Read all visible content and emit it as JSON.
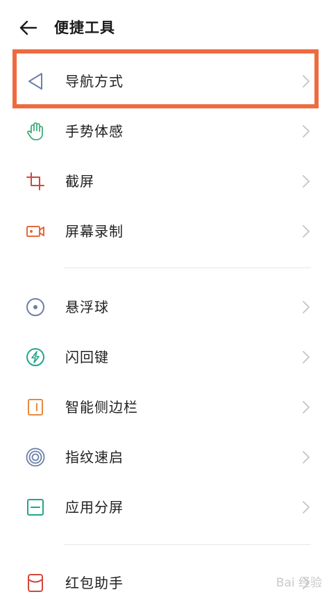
{
  "header": {
    "title": "便捷工具"
  },
  "items": [
    {
      "label": "导航方式",
      "icon": "navigation-triangle-icon",
      "color": "#6b7fa8"
    },
    {
      "label": "手势体感",
      "icon": "hand-gesture-icon",
      "color": "#3fae7a"
    },
    {
      "label": "截屏",
      "icon": "crop-screenshot-icon",
      "color": "#d2463c"
    },
    {
      "label": "屏幕录制",
      "icon": "screen-record-icon",
      "color": "#e26a3a"
    },
    {
      "label": "悬浮球",
      "icon": "floating-ball-icon",
      "color": "#6b7fa8"
    },
    {
      "label": "闪回键",
      "icon": "flashback-key-icon",
      "color": "#22a58a"
    },
    {
      "label": "智能侧边栏",
      "icon": "smart-sidebar-icon",
      "color": "#e8893f"
    },
    {
      "label": "指纹速启",
      "icon": "fingerprint-icon",
      "color": "#6b7fa8"
    },
    {
      "label": "应用分屏",
      "icon": "split-screen-icon",
      "color": "#22a58a"
    },
    {
      "label": "红包助手",
      "icon": "red-envelope-icon",
      "color": "#d2463c"
    }
  ],
  "highlight_color": "#ee6b3f",
  "watermark": "Bai 经验"
}
